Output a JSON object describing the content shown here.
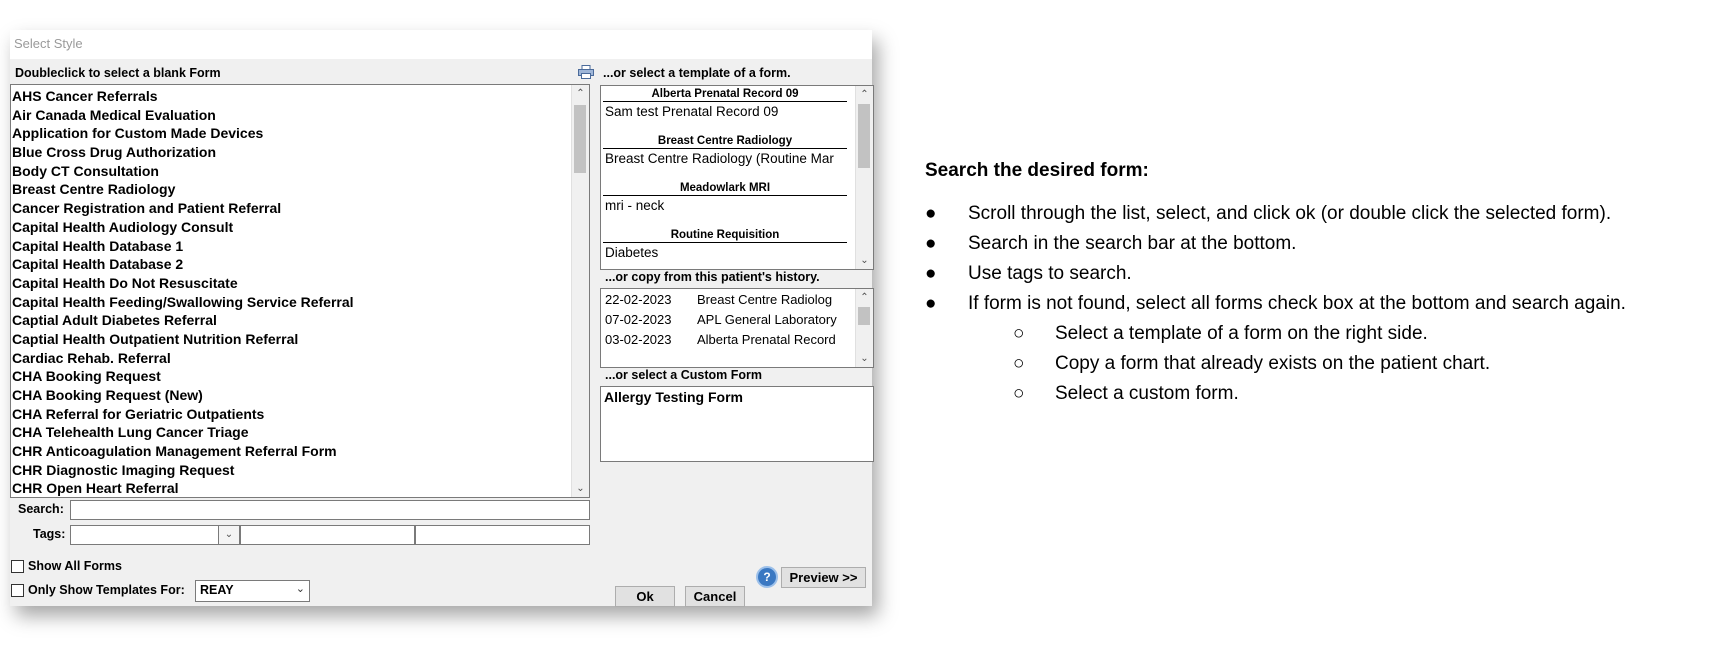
{
  "dialog": {
    "title": "Select Style",
    "blank_form_header": "Doubleclick to select a blank Form",
    "template_header": "...or select a template of a form.",
    "history_header": "...or copy from this patient's history.",
    "custom_header": "...or select a Custom Form",
    "forms": [
      " AHS Cancer Referrals",
      "Air Canada Medical Evaluation",
      "Application for Custom Made Devices",
      "Blue Cross Drug Authorization",
      "Body CT Consultation",
      "Breast Centre Radiology",
      "Cancer Registration and Patient Referral",
      "Capital Health Audiology Consult",
      "Capital Health Database 1",
      "Capital Health Database 2",
      "Capital Health Do Not Resuscitate",
      "Capital Health Feeding/Swallowing Service Referral",
      "Captial Adult Diabetes Referral",
      "Captial Health Outpatient Nutrition Referral",
      "Cardiac Rehab. Referral",
      "CHA Booking Request",
      "CHA Booking Request (New)",
      "CHA Referral for Geriatric Outpatients",
      "CHA Telehealth Lung Cancer Triage",
      "CHR Anticoagulation Management Referral Form",
      "CHR Diagnostic Imaging Request",
      "CHR Open Heart Referral"
    ],
    "templates": [
      {
        "group": "Alberta Prenatal Record 09",
        "item": "Sam test Prenatal Record 09"
      },
      {
        "group": "Breast Centre Radiology",
        "item": "Breast Centre Radiology (Routine Mar"
      },
      {
        "group": "Meadowlark MRI",
        "item": "mri - neck"
      },
      {
        "group": "Routine Requisition",
        "item": "Diabetes"
      }
    ],
    "history": [
      {
        "date": "22-02-2023",
        "form": "Breast Centre Radiolog"
      },
      {
        "date": "07-02-2023",
        "form": "APL General Laboratory"
      },
      {
        "date": "03-02-2023",
        "form": "Alberta Prenatal Record"
      }
    ],
    "custom_forms": [
      "Allergy Testing Form"
    ],
    "search_label": "Search:",
    "search_value": "",
    "tags_label": "Tags:",
    "show_all_label": "Show All Forms",
    "only_show_label": "Only Show Templates For:",
    "only_show_value": "REAY",
    "ok_label": "Ok",
    "cancel_label": "Cancel",
    "help_label": "?",
    "preview_label": "Preview >>"
  },
  "instructions": {
    "heading": "Search the desired form:",
    "bullets": [
      "Scroll through the list, select, and click ok (or double click the selected form).",
      "Search in the search bar at the bottom.",
      "Use tags to search.",
      "If form is not found, select all forms check box at the bottom and search again."
    ],
    "sub_bullets": [
      "Select a template of a form on the right side.",
      "Copy a form that already exists on the patient chart.",
      "Select a custom form."
    ]
  }
}
